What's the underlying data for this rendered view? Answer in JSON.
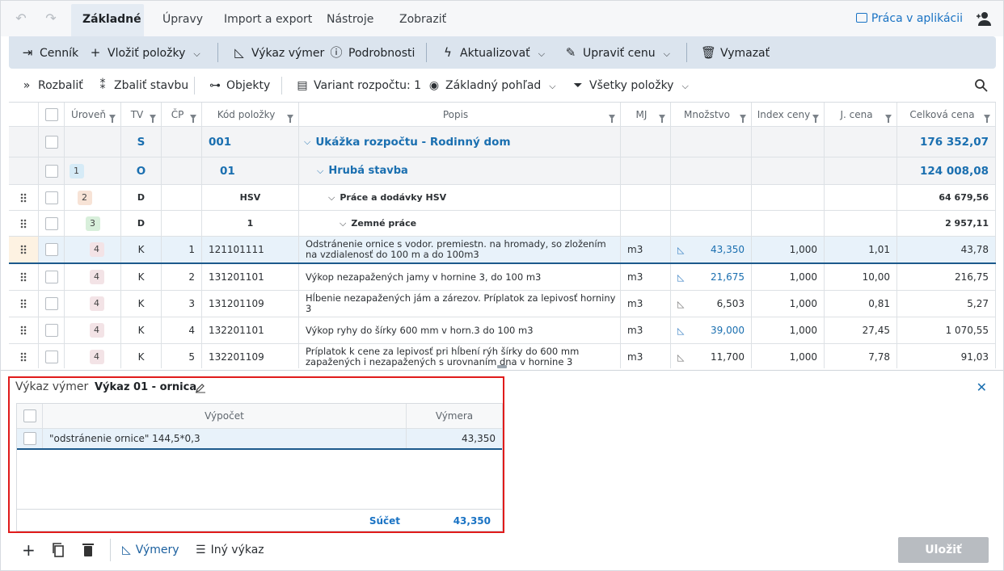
{
  "tabs": [
    "Základné",
    "Úpravy",
    "Import a export",
    "Nástroje",
    "Zobraziť"
  ],
  "praca_link": "Práca v aplikácii",
  "ribbon": {
    "cennik": "Cenník",
    "vlozit": "Vložiť položky",
    "vykaz": "Výkaz výmer",
    "podrobnosti": "Podrobnosti",
    "aktualizovat": "Aktualizovať",
    "upravit": "Upraviť cenu",
    "vymazat": "Vymazať"
  },
  "toolbar": {
    "rozbalit": "Rozbaliť",
    "zbalit": "Zbaliť stavbu",
    "objekty": "Objekty",
    "variant": "Variant rozpočtu: 1",
    "pohlad": "Základný pohľad",
    "polozky": "Všetky položky"
  },
  "columns": [
    "Úroveň",
    "TV",
    "ČP",
    "Kód položky",
    "Popis",
    "MJ",
    "Množstvo",
    "Index ceny",
    "J. cena",
    "Celková cena"
  ],
  "rows": [
    {
      "lvl": "",
      "tv": "S",
      "cp": "",
      "kod": "001",
      "popis": "Ukážka rozpočtu - Rodinný dom",
      "mj": "",
      "mn": "",
      "idx": "",
      "jc": "",
      "cc": "176 352,07"
    },
    {
      "lvl": "1",
      "tv": "O",
      "cp": "",
      "kod": "01",
      "popis": "Hrubá stavba",
      "mj": "",
      "mn": "",
      "idx": "",
      "jc": "",
      "cc": "124 008,08"
    },
    {
      "lvl": "2",
      "tv": "D",
      "cp": "",
      "kod": "HSV",
      "popis": "Práce a dodávky HSV",
      "mj": "",
      "mn": "",
      "idx": "",
      "jc": "",
      "cc": "64 679,56"
    },
    {
      "lvl": "3",
      "tv": "D",
      "cp": "",
      "kod": "1",
      "popis": "Zemné práce",
      "mj": "",
      "mn": "",
      "idx": "",
      "jc": "",
      "cc": "2 957,11"
    },
    {
      "lvl": "4",
      "tv": "K",
      "cp": "1",
      "kod": "121101111",
      "popis": "Odstránenie ornice s vodor. premiestn. na hromady, so zložením na vzdialenosť do 100 m a do 100m3",
      "mj": "m3",
      "mn": "43,350",
      "idx": "1,000",
      "jc": "1,01",
      "cc": "43,78"
    },
    {
      "lvl": "4",
      "tv": "K",
      "cp": "2",
      "kod": "131201101",
      "popis": "Výkop nezapažených jamy v hornine 3, do 100 m3",
      "mj": "m3",
      "mn": "21,675",
      "idx": "1,000",
      "jc": "10,00",
      "cc": "216,75"
    },
    {
      "lvl": "4",
      "tv": "K",
      "cp": "3",
      "kod": "131201109",
      "popis": "Hĺbenie nezapažených jám a zárezov. Príplatok za lepivosť horniny 3",
      "mj": "m3",
      "mn": "6,503",
      "idx": "1,000",
      "jc": "0,81",
      "cc": "5,27"
    },
    {
      "lvl": "4",
      "tv": "K",
      "cp": "4",
      "kod": "132201101",
      "popis": "Výkop ryhy do šírky 600 mm v horn.3 do 100 m3",
      "mj": "m3",
      "mn": "39,000",
      "idx": "1,000",
      "jc": "27,45",
      "cc": "1 070,55"
    },
    {
      "lvl": "4",
      "tv": "K",
      "cp": "5",
      "kod": "132201109",
      "popis": "Príplatok k cene za lepivosť pri hĺbení rýh šírky do 600 mm zapažených i nezapažených s urovnaním dna v hornine 3",
      "mj": "m3",
      "mn": "11,700",
      "idx": "1,000",
      "jc": "7,78",
      "cc": "91,03"
    }
  ],
  "panel": {
    "title": "Výkaz výmer",
    "name": "Výkaz 01 - ornica",
    "col_vypocet": "Výpočet",
    "col_vymera": "Výmera",
    "row_vypocet": "\"odstránenie ornice\" 144,5*0,3",
    "row_vymera": "43,350",
    "sum_label": "Súčet",
    "sum_value": "43,350",
    "vymery": "Výmery",
    "iny": "Iný výkaz",
    "save": "Uložiť"
  },
  "colors": {
    "accent": "#1a73c4",
    "highlight": "#e01b1b"
  }
}
